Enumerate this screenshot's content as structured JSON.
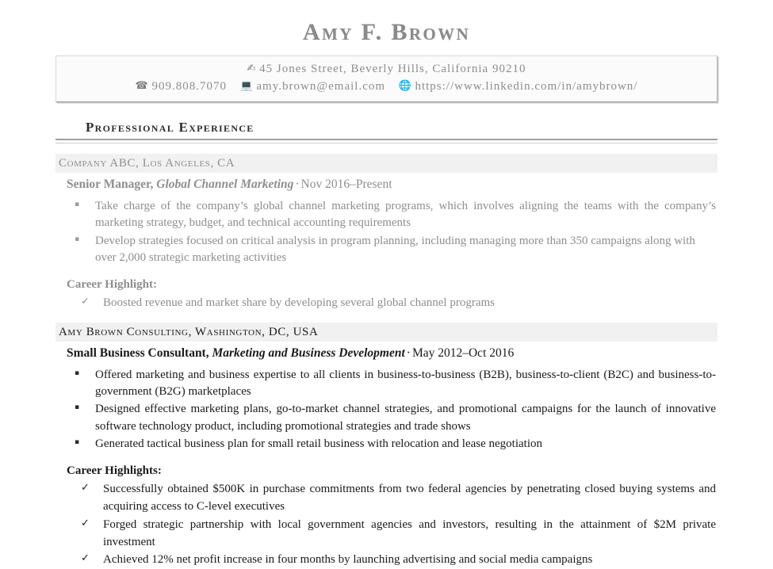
{
  "header": {
    "name": "Amy F. Brown"
  },
  "contact": {
    "address_icon": "location-mail-icon",
    "address_icon_glyph": "✍",
    "address": "45 Jones Street, Beverly Hills, California 90210",
    "phone_icon": "telephone-icon",
    "phone_icon_glyph": "☎",
    "phone": "909.808.7070",
    "email_icon": "laptop-icon",
    "email_icon_glyph": "💻",
    "email": "amy.brown@email.com",
    "website_icon": "globe-icon",
    "website_icon_glyph": "🌐",
    "website": "https://www.linkedin.com/in/amybrown/"
  },
  "section": {
    "title": "Professional Experience"
  },
  "markers": {
    "square": "▪",
    "check": "✓"
  },
  "jobs": [
    {
      "company": "Company ABC, Los Angeles, CA",
      "role": "Senior Manager,",
      "specialty": "Global Channel Marketing",
      "separator": "·",
      "dates": "Nov 2016–Present",
      "bullets": [
        "Take charge of the company’s global channel marketing programs, which involves aligning the teams with the company’s marketing strategy, budget, and technical accounting requirements",
        "Develop strategies focused on critical analysis in program planning, including managing more than 350 campaigns along with over 2,000 strategic marketing activities"
      ],
      "highlight_label": "Career Highlight:",
      "highlights": [
        "Boosted revenue and market share by developing several global channel programs"
      ]
    },
    {
      "company": "Amy Brown Consulting, Washington, DC, USA",
      "role": "Small Business Consultant,",
      "specialty": "Marketing and Business Development",
      "separator": "·",
      "dates": "May 2012–Oct 2016",
      "bullets": [
        "Offered marketing and business expertise to all clients in business-to-business (B2B), business-to-client (B2C) and business-to-government (B2G) marketplaces",
        "Designed effective marketing plans, go-to-market channel strategies, and promotional campaigns for the launch of innovative software technology product, including promotional strategies and trade shows",
        "Generated tactical business plan for small retail business with relocation and lease negotiation"
      ],
      "highlight_label": "Career Highlights:",
      "highlights": [
        "Successfully obtained $500K in purchase commitments from two federal agencies by penetrating closed buying systems and acquiring access to C-level executives",
        "Forged strategic partnership with local government agencies and investors, resulting in the attainment of $2M private investment",
        "Achieved 12% net profit increase in four months by launching advertising and social media campaigns"
      ]
    }
  ],
  "colors": {
    "name": "#8a8a8a",
    "muted_text": "#8e8e8e",
    "dark_text": "#1a1a1a",
    "company_band": "#f1f1f1",
    "rule_strong": "#9e9e9e",
    "rule_light": "#cccccc"
  }
}
